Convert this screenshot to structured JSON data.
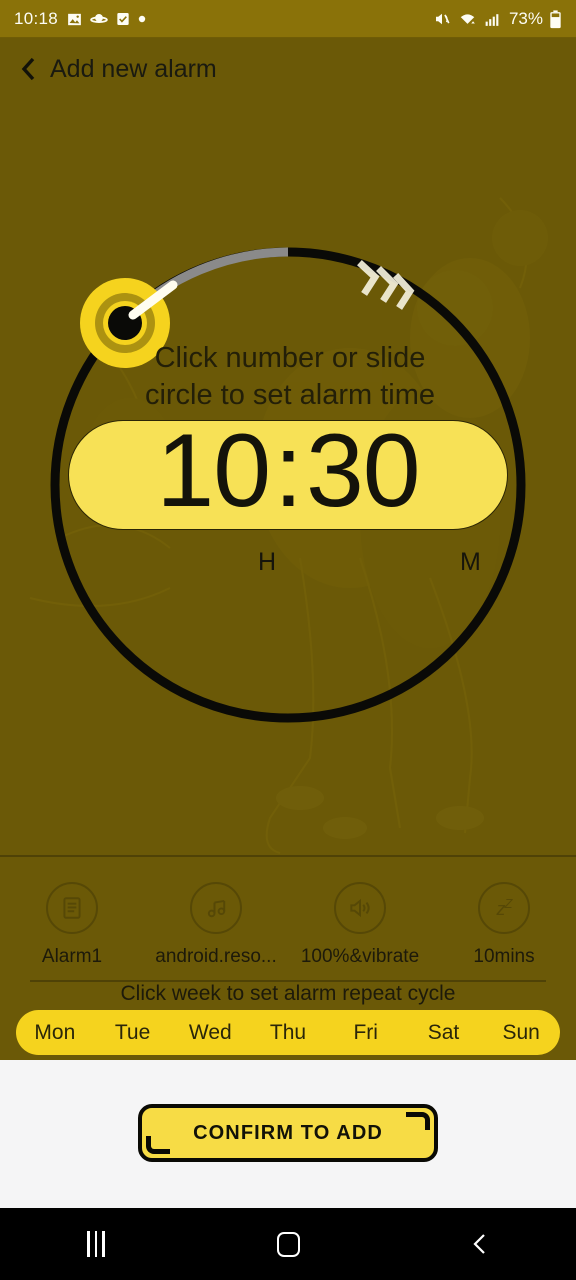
{
  "status_bar": {
    "time": "10:18",
    "left_icons": [
      "image-icon",
      "planet-icon",
      "checkbox-icon",
      "dot-icon"
    ],
    "right_icons": [
      "mute-vibrate-icon",
      "wifi-icon",
      "cellular-signal-icon"
    ],
    "battery_percent": "73%",
    "battery_icon": "battery-icon",
    "background_color": "#8a7209",
    "text_color": "#fdfdf5"
  },
  "header": {
    "back_icon": "chevron-left-icon",
    "title": "Add new alarm"
  },
  "clock": {
    "hint": "Click number or slide\ncircle to set alarm time",
    "hint_line1": "Click number or slide",
    "hint_line2": "circle to set alarm time",
    "hours": "10",
    "colon": ":",
    "minutes": "30",
    "hour_label": "H",
    "minute_label": "M",
    "dial_colors": {
      "ring": "#0a0a07",
      "progress": "#8a8a8a",
      "knob_outer": "#f5d31e",
      "knob_inner": "#0a0a07",
      "pill": "#f7e156"
    },
    "drag_arrows_icon": "chevron-double-right-icon"
  },
  "options": [
    {
      "icon": "alarm-label-icon",
      "label": "Alarm1"
    },
    {
      "icon": "music-note-icon",
      "label": "android.reso..."
    },
    {
      "icon": "volume-icon",
      "label": "100%&vibrate"
    },
    {
      "icon": "snooze-icon",
      "label": "10mins",
      "glyph": "z",
      "glyph_sup": "Z"
    }
  ],
  "week": {
    "hint": "Click week to set alarm repeat cycle",
    "days": [
      "Mon",
      "Tue",
      "Wed",
      "Thu",
      "Fri",
      "Sat",
      "Sun"
    ],
    "pill_color": "#f5d31e"
  },
  "confirm": {
    "label": "CONFIRM TO ADD",
    "fill": "#f7dc45",
    "border": "#0a0a05"
  },
  "nav_bar": {
    "recents_icon": "recents-icon",
    "home_icon": "home-icon",
    "back_icon": "chevron-left-icon"
  },
  "theme": {
    "background": "#6b5a07",
    "accent": "#f5d31e",
    "text_dark": "#1a1a10"
  }
}
